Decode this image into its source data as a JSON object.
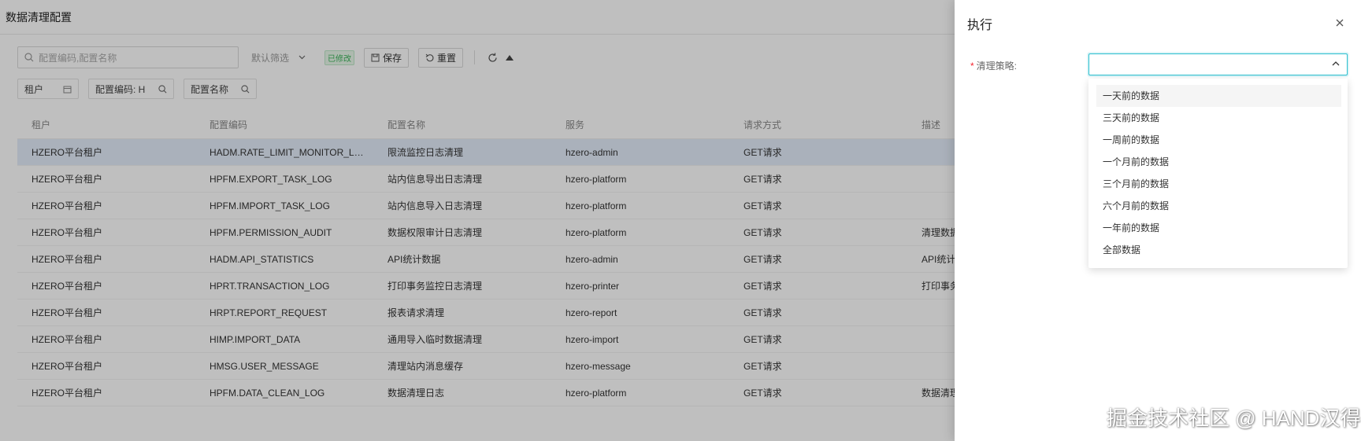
{
  "page": {
    "title": "数据清理配置",
    "search": {
      "placeholder": "配置编码,配置名称"
    },
    "filter_label": "默认筛选",
    "modified_tag": "已修改",
    "save_label": "保存",
    "reset_label": "重置",
    "chips": [
      {
        "label": "租户",
        "icon": "calendar-icon"
      },
      {
        "label": "配置编码: H",
        "icon": "search-icon"
      },
      {
        "label": "配置名称",
        "icon": "search-icon"
      }
    ],
    "table": {
      "columns": [
        "租户",
        "配置编码",
        "配置名称",
        "服务",
        "请求方式",
        "描述"
      ],
      "rows": [
        [
          "HZERO平台租户",
          "HADM.RATE_LIMIT_MONITOR_LOG",
          "限流监控日志清理",
          "hzero-admin",
          "GET请求",
          ""
        ],
        [
          "HZERO平台租户",
          "HPFM.EXPORT_TASK_LOG",
          "站内信息导出日志清理",
          "hzero-platform",
          "GET请求",
          ""
        ],
        [
          "HZERO平台租户",
          "HPFM.IMPORT_TASK_LOG",
          "站内信息导入日志清理",
          "hzero-platform",
          "GET请求",
          ""
        ],
        [
          "HZERO平台租户",
          "HPFM.PERMISSION_AUDIT",
          "数据权限审计日志清理",
          "hzero-platform",
          "GET请求",
          "清理数据"
        ],
        [
          "HZERO平台租户",
          "HADM.API_STATISTICS",
          "API统计数据",
          "hzero-admin",
          "GET请求",
          "API统计"
        ],
        [
          "HZERO平台租户",
          "HPRT.TRANSACTION_LOG",
          "打印事务监控日志清理",
          "hzero-printer",
          "GET请求",
          "打印事务"
        ],
        [
          "HZERO平台租户",
          "HRPT.REPORT_REQUEST",
          "报表请求清理",
          "hzero-report",
          "GET请求",
          ""
        ],
        [
          "HZERO平台租户",
          "HIMP.IMPORT_DATA",
          "通用导入临时数据清理",
          "hzero-import",
          "GET请求",
          ""
        ],
        [
          "HZERO平台租户",
          "HMSG.USER_MESSAGE",
          "清理站内消息缓存",
          "hzero-message",
          "GET请求",
          ""
        ],
        [
          "HZERO平台租户",
          "HPFM.DATA_CLEAN_LOG",
          "数据清理日志",
          "hzero-platform",
          "GET请求",
          "数据清理"
        ]
      ]
    }
  },
  "drawer": {
    "title": "执行",
    "field_label": "清理策略:",
    "field_value": "",
    "options": [
      "一天前的数据",
      "三天前的数据",
      "一周前的数据",
      "一个月前的数据",
      "三个月前的数据",
      "六个月前的数据",
      "一年前的数据",
      "全部数据"
    ]
  },
  "watermark": "掘金技术社区 @ HAND汉得",
  "colors": {
    "accent": "#29bece",
    "required": "#f5222d",
    "selected_row": "#e3ecfa"
  }
}
